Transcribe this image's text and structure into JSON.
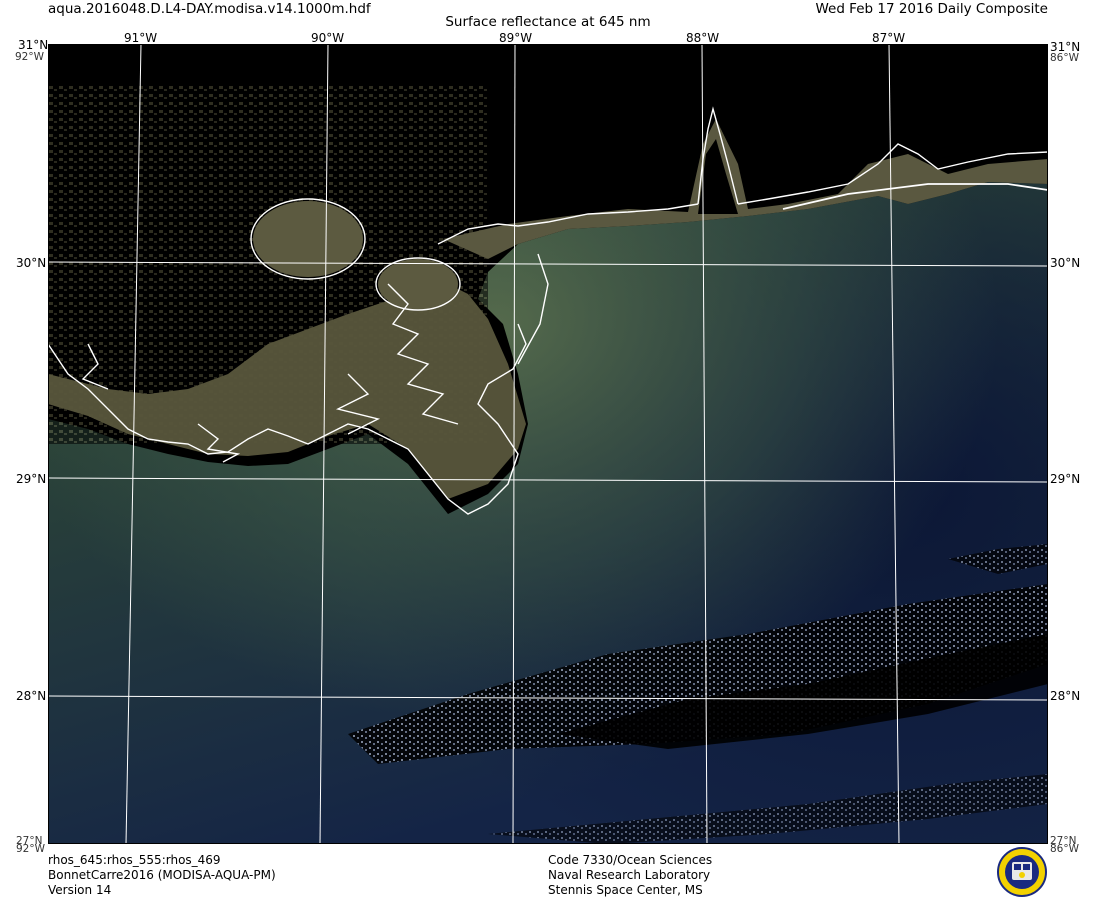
{
  "header": {
    "filename": "aqua.2016048.D.L4-DAY.modisa.v14.1000m.hdf",
    "title": "Surface reflectance at 645 nm",
    "date": "Wed Feb 17 2016 Daily Composite"
  },
  "map": {
    "top_lon_labels": [
      "91°W",
      "90°W",
      "89°W",
      "88°W",
      "87°W"
    ],
    "left_lat_labels": [
      "30°N",
      "29°N",
      "28°N"
    ],
    "right_lat_labels": [
      "30°N",
      "29°N",
      "28°N"
    ],
    "corner_top_left": "31°N",
    "corner_top_left_under": "92°W",
    "corner_top_right": "31°N",
    "corner_top_right_under": "86°W",
    "corner_bottom_left": "27°N",
    "corner_bottom_left_under": "92°W",
    "corner_bottom_right": "27°N",
    "corner_bottom_right_under": "86°W",
    "lon_range": [
      -92,
      -86
    ],
    "lat_range": [
      27,
      31
    ],
    "grid": true,
    "colors": {
      "land": "#58563c",
      "water_coastal": "#3f5e3a",
      "water_offshore": "#0e1b3a",
      "gridline": "#ffffff",
      "coastline": "#ffffff",
      "nodata": "#000000"
    }
  },
  "footer": {
    "left_line1": "rhos_645:rhos_555:rhos_469",
    "left_line2": "BonnetCarre2016 (MODISA-AQUA-PM)",
    "left_line3": "Version 14",
    "center_line1": "Code 7330/Ocean Sciences",
    "center_line2": "Naval Research Laboratory",
    "center_line3": "Stennis Space Center, MS",
    "logo_icon": "nrl-seal-icon"
  }
}
